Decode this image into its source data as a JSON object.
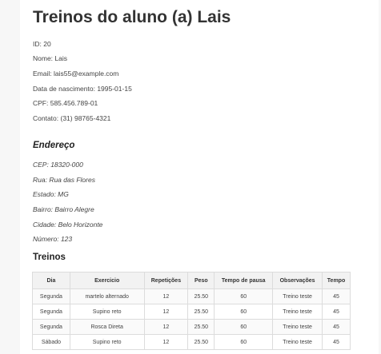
{
  "title": "Treinos do aluno (a) Lais",
  "info": [
    "ID: 20",
    "Nome: Lais",
    "Email: lais55@example.com",
    "Data de nascimento: 1995-01-15",
    "CPF: 585.456.789-01",
    "Contato: (31) 98765-4321"
  ],
  "address": {
    "heading": "Endereço",
    "lines": [
      "CEP: 18320-000",
      "Rua: Rua das Flores",
      "Estado: MG",
      "Bairro: Bairro Alegre",
      "Cidade: Belo Horizonte",
      "Número: 123"
    ]
  },
  "trainings": {
    "heading": "Treinos",
    "columns": [
      "Dia",
      "Exercicio",
      "Repetições",
      "Peso",
      "Tempo de pausa",
      "Observações",
      "Tempo"
    ],
    "rows": [
      [
        "Segunda",
        "martelo alternado",
        "12",
        "25.50",
        "60",
        "Treino teste",
        "45"
      ],
      [
        "Segunda",
        "Supino reto",
        "12",
        "25.50",
        "60",
        "Treino teste",
        "45"
      ],
      [
        "Segunda",
        "Rosca Direta",
        "12",
        "25.50",
        "60",
        "Treino teste",
        "45"
      ],
      [
        "Sábado",
        "Supino reto",
        "12",
        "25.50",
        "60",
        "Treino teste",
        "45"
      ]
    ]
  }
}
